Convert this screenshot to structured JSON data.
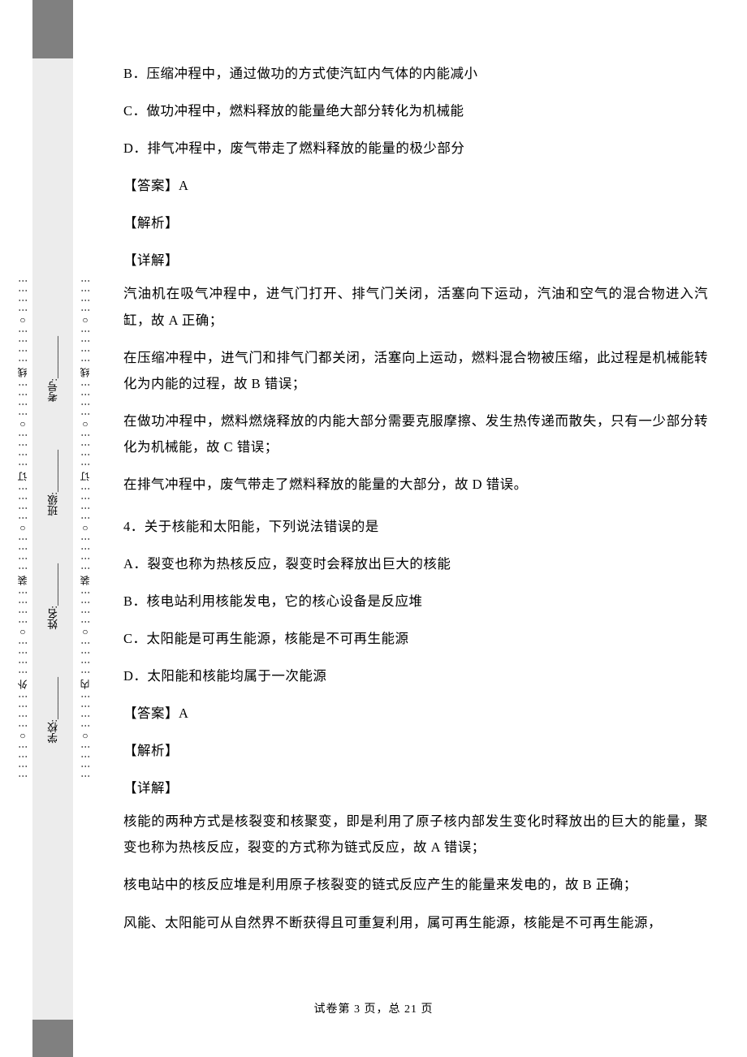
{
  "gutter": {
    "left_marks": "⋮⋮⋮⋮○⋮⋮⋮⋮ 外 ⋮⋮⋮⋮○⋮⋮⋮⋮ 装 ⋮⋮⋮⋮○⋮⋮⋮⋮ 订 ⋮⋮⋮⋮○⋮⋮⋮⋮ 线 ⋮⋮⋮⋮○⋮⋮⋮⋮",
    "right_marks": "⋮⋮⋮⋮○⋮⋮⋮⋮ 内 ⋮⋮⋮⋮○⋮⋮⋮⋮ 装 ⋮⋮⋮⋮○⋮⋮⋮⋮ 订 ⋮⋮⋮⋮○⋮⋮⋮⋮ 线 ⋮⋮⋮⋮○⋮⋮⋮⋮",
    "fields": {
      "school": "学校:________",
      "name": "姓名:________",
      "class": "班级:________",
      "exam": "考号:________"
    }
  },
  "content": {
    "optB": "B．压缩冲程中，通过做功的方式使汽缸内气体的内能减小",
    "optC": "C．做功冲程中，燃料释放的能量绝大部分转化为机械能",
    "optD": "D．排气冲程中，废气带走了燃料释放的能量的极少部分",
    "ans1_label": "【答案】",
    "ans1_val": "A",
    "jiexi": "【解析】",
    "xiangjie": "【详解】",
    "p1": "汽油机在吸气冲程中，进气门打开、排气门关闭，活塞向下运动，汽油和空气的混合物进入汽缸，故 A 正确；",
    "p2": "在压缩冲程中，进气门和排气门都关闭，活塞向上运动，燃料混合物被压缩，此过程是机械能转化为内能的过程，故 B 错误；",
    "p3": "在做功冲程中，燃料燃烧释放的内能大部分需要克服摩擦、发生热传递而散失，只有一少部分转化为机械能，故 C 错误；",
    "p4": "在排气冲程中，废气带走了燃料释放的能量的大部分，故 D 错误。",
    "q4": "4．关于核能和太阳能，下列说法错误的是",
    "q4A": "A．裂变也称为热核反应，裂变时会释放出巨大的核能",
    "q4B": "B．核电站利用核能发电，它的核心设备是反应堆",
    "q4C": "C．太阳能是可再生能源，核能是不可再生能源",
    "q4D": "D．太阳能和核能均属于一次能源",
    "ans2_label": "【答案】",
    "ans2_val": "A",
    "p5": "核能的两种方式是核裂变和核聚变，即是利用了原子核内部发生变化时释放出的巨大的能量，聚变也称为热核反应，裂变的方式称为链式反应，故 A 错误；",
    "p6": "核电站中的核反应堆是利用原子核裂变的链式反应产生的能量来发电的，故 B 正确；",
    "p7": "风能、太阳能可从自然界不断获得且可重复利用，属可再生能源，核能是不可再生能源，"
  },
  "footer": "试卷第 3 页，总 21 页"
}
